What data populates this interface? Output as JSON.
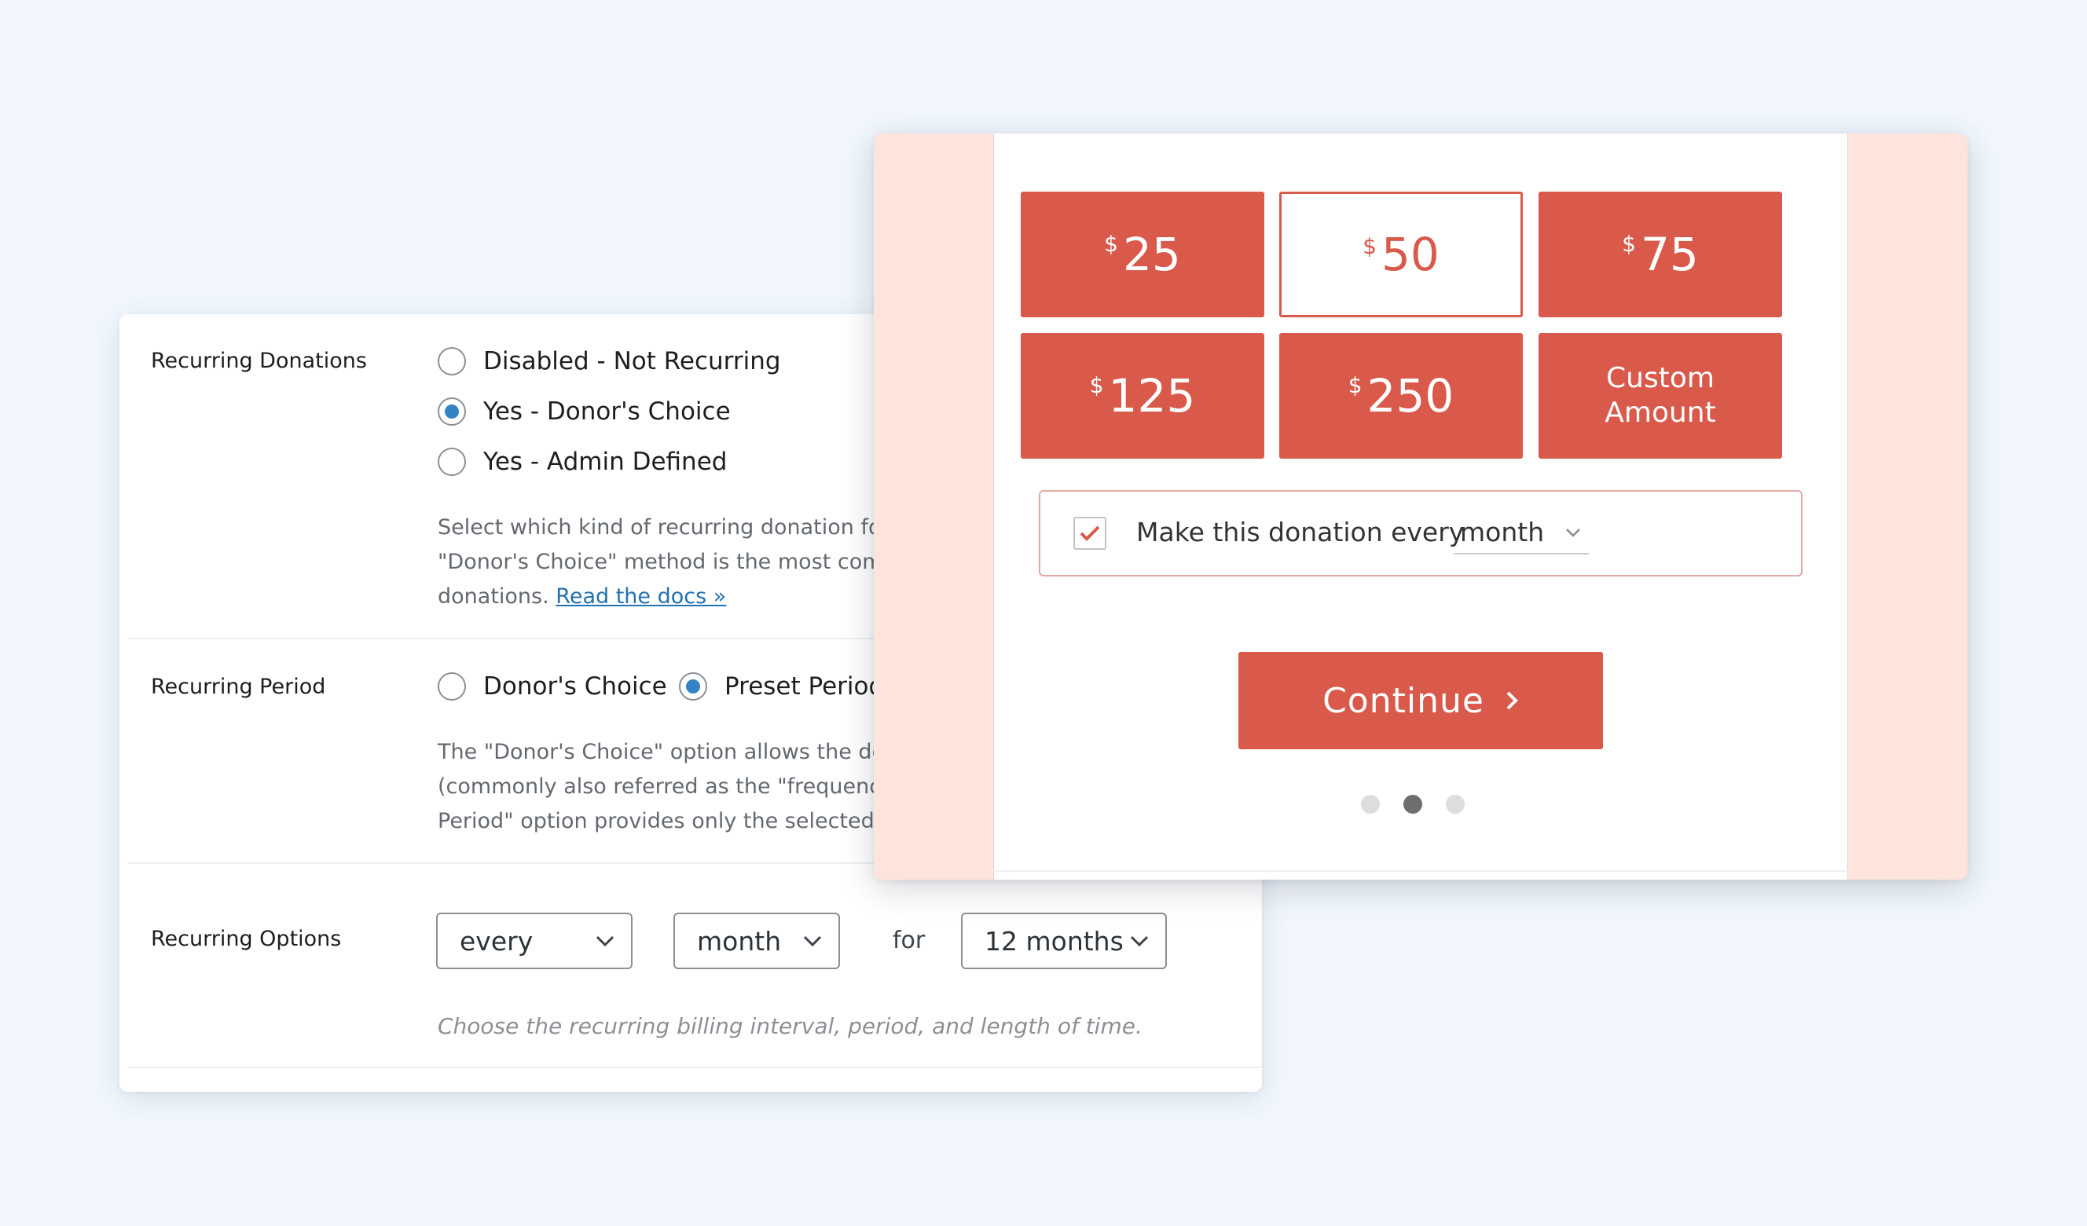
{
  "settings": {
    "recurring_donations": {
      "label": "Recurring Donations",
      "options": [
        {
          "label": "Disabled - Not Recurring",
          "checked": false
        },
        {
          "label": "Yes - Donor's Choice",
          "checked": true
        },
        {
          "label": "Yes - Admin Defined",
          "checked": false
        }
      ],
      "description_lines": [
        "Select which kind of recurring donation for",
        "\"Donor's Choice\" method is the most comm",
        "donations."
      ],
      "docs_link": "Read the docs »"
    },
    "recurring_period": {
      "label": "Recurring Period",
      "options": [
        {
          "label": "Donor's Choice",
          "checked": false
        },
        {
          "label": "Preset Period",
          "checked": true
        }
      ],
      "description_lines": [
        "The \"Donor's Choice\" option allows the don",
        "(commonly also referred as the \"frequency\"",
        "Period\" option provides only the selected p"
      ]
    },
    "recurring_options": {
      "label": "Recurring Options",
      "interval": "every",
      "period": "month",
      "for_label": "for",
      "length": "12 months",
      "hint": "Choose the recurring billing interval, period, and length of time."
    }
  },
  "donation_form": {
    "currency_symbol": "$",
    "amounts": [
      {
        "value": "25",
        "selected": false
      },
      {
        "value": "50",
        "selected": true
      },
      {
        "value": "75",
        "selected": false
      },
      {
        "value": "125",
        "selected": false
      },
      {
        "value": "250",
        "selected": false
      }
    ],
    "custom_amount_label": "Custom Amount",
    "recurring_checkbox_checked": true,
    "recurring_text": "Make this donation every",
    "recurring_period": "month",
    "continue_label": "Continue",
    "steps": {
      "total": 3,
      "current": 2
    }
  },
  "colors": {
    "accent": "#d9594b",
    "radio_checked": "#3582c4",
    "link": "#2271b1",
    "panel_background": "#fee4dd",
    "page_background": "#f1f7fd"
  }
}
